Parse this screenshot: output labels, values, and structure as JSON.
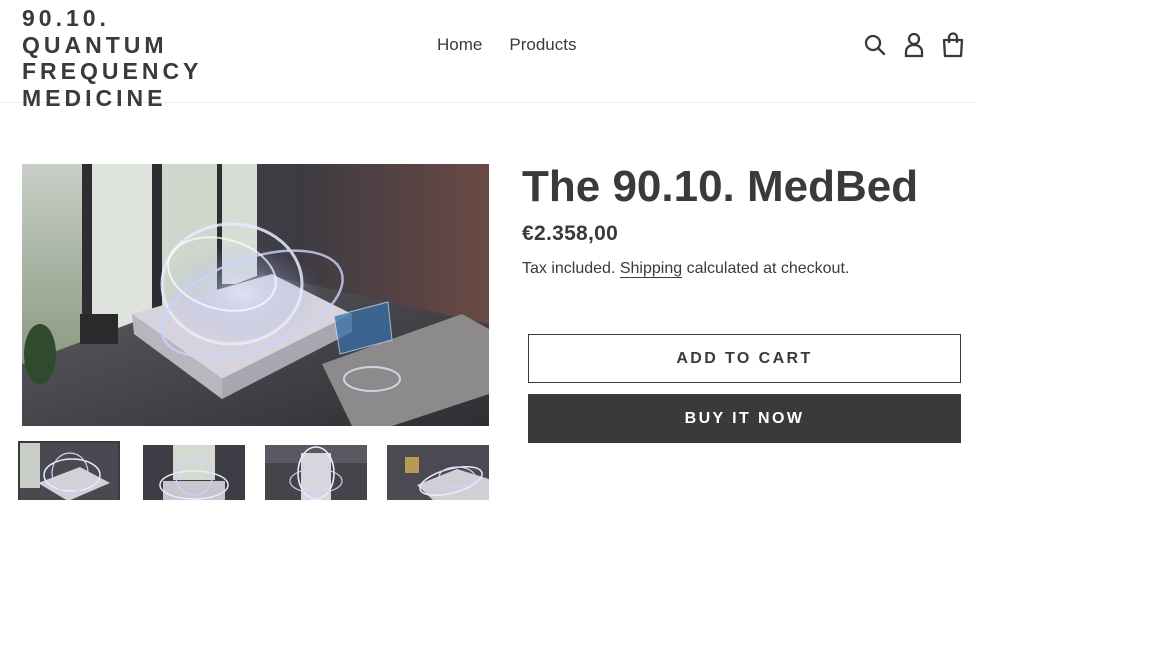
{
  "header": {
    "logo_text": "90.10. QUANTUM FREQUENCY MEDICINE",
    "nav": [
      {
        "label": "Home"
      },
      {
        "label": "Products"
      }
    ],
    "icons": [
      "search-icon",
      "account-icon",
      "cart-icon"
    ]
  },
  "product": {
    "title": "The 90.10. MedBed",
    "price": "€2.358,00",
    "tax_prefix": "Tax included.",
    "shipping_link": "Shipping",
    "tax_suffix": "calculated at checkout.",
    "add_to_cart_label": "Add to cart",
    "buy_now_label": "Buy it now",
    "thumbnail_count": 4,
    "active_thumbnail": 1
  },
  "colors": {
    "text": "#3a3a3a",
    "button_dark": "#3a3a3a",
    "button_text_light": "#ffffff",
    "divider": "#ececec"
  }
}
